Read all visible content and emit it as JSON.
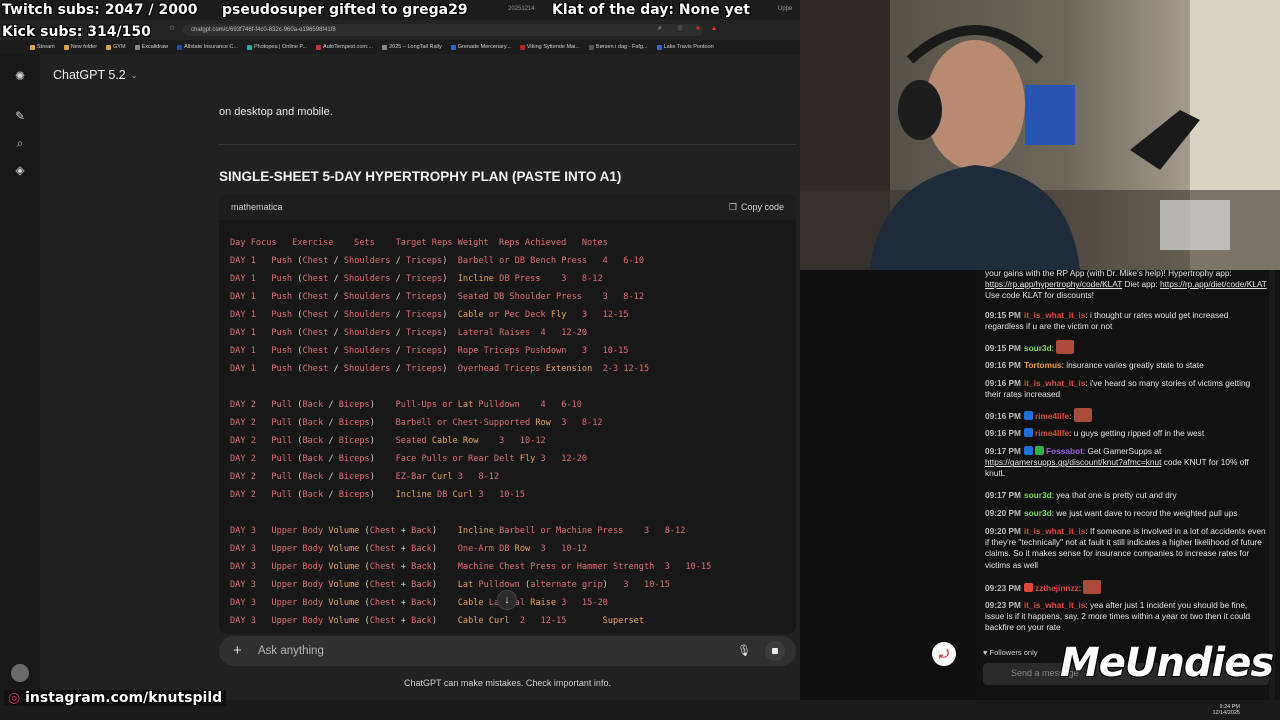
{
  "overlay": {
    "subs": "Twitch subs: 2047 / 2000",
    "gifted": "pseudosuper gifted to grega29",
    "klat": "Klat of the day: None yet",
    "kick": "Kick subs: 314/150",
    "instagram": "instagram.com/knutspild",
    "sponsor": "MeUndies"
  },
  "browser": {
    "tabs": [
      "20251214",
      "Uppe"
    ],
    "url": "chatgpt.com/c/693f746f-f4c0-832c-960a-e196598f41f8",
    "bookmarks": [
      "Stream",
      "New folder",
      "GYM",
      "Excalidraw",
      "Allstate Insurance C...",
      "Photopea | Online P...",
      "AutoTempest.com:...",
      "2025 – LongTail Rally",
      "Grenade Mercenary...",
      "Viking Syttende Mai...",
      "Børsen i dag - Fafg...",
      "Lake Travis Pontoon"
    ]
  },
  "chatgpt": {
    "model": "ChatGPT 5.2",
    "paragraph": "on desktop and mobile.",
    "heading": "SINGLE-SHEET 5-DAY HYPERTROPHY PLAN (PASTE INTO A1)",
    "code_lang": "mathematica",
    "copy_label": "Copy code",
    "composer_placeholder": "Ask anything",
    "disclaimer": "ChatGPT can make mistakes. Check important info.",
    "code_lines": [
      "Day Focus   Exercise    Sets    Target Reps Weight  Reps Achieved   Notes",
      "DAY 1   Push (Chest / Shoulders / Triceps)  Barbell or DB Bench Press   4   6-10",
      "DAY 1   Push (Chest / Shoulders / Triceps)  Incline DB Press    3   8-12",
      "DAY 1   Push (Chest / Shoulders / Triceps)  Seated DB Shoulder Press    3   8-12",
      "DAY 1   Push (Chest / Shoulders / Triceps)  Cable or Pec Deck Fly   3   12-15",
      "DAY 1   Push (Chest / Shoulders / Triceps)  Lateral Raises  4   12-20",
      "DAY 1   Push (Chest / Shoulders / Triceps)  Rope Triceps Pushdown   3   10-15",
      "DAY 1   Push (Chest / Shoulders / Triceps)  Overhead Triceps Extension  2-3 12-15",
      "",
      "DAY 2   Pull (Back / Biceps)    Pull-Ups or Lat Pulldown    4   6-10",
      "DAY 2   Pull (Back / Biceps)    Barbell or Chest-Supported Row  3   8-12",
      "DAY 2   Pull (Back / Biceps)    Seated Cable Row    3   10-12",
      "DAY 2   Pull (Back / Biceps)    Face Pulls or Rear Delt Fly 3   12-20",
      "DAY 2   Pull (Back / Biceps)    EZ-Bar Curl 3   8-12",
      "DAY 2   Pull (Back / Biceps)    Incline DB Curl 3   10-15",
      "",
      "DAY 3   Upper Body Volume (Chest + Back)    Incline Barbell or Machine Press    3   8-12",
      "DAY 3   Upper Body Volume (Chest + Back)    One-Arm DB Row  3   10-12",
      "DAY 3   Upper Body Volume (Chest + Back)    Machine Chest Press or Hammer Strength  3   10-15",
      "DAY 3   Upper Body Volume (Chest + Back)    Lat Pulldown (alternate grip)   3   10-15",
      "DAY 3   Upper Body Volume (Chest + Back)    Cable Lateral Raise 3   15-20",
      "DAY 3   Upper Body Volume (Chest + Back)    Cable Curl  2   12-15       Superset"
    ]
  },
  "chat": {
    "messages": [
      {
        "time": "",
        "user": "",
        "text": "your gains with the RP App (with Dr. Mike's help)! Hypertrophy app:",
        "link": "https://rp.app/hypertrophy/code/KLAT",
        "after": "Diet app:",
        "link2": "https://rp.app/diet/code/KLAT",
        "after2": "Use code KLAT for discounts!"
      },
      {
        "time": "09:15 PM",
        "user": "it_is_what_it_is",
        "color": "#e0463c",
        "text": "i thought ur rates would get increased regardless if u are the victim or not"
      },
      {
        "time": "09:15 PM",
        "user": "sour3d",
        "color": "#7ed957",
        "text": ""
      },
      {
        "time": "09:16 PM",
        "user": "Tortomus",
        "color": "#f0a030",
        "text": "insurance varies greatly state to state"
      },
      {
        "time": "09:16 PM",
        "user": "it_is_what_it_is",
        "color": "#e0463c",
        "text": "i've heard so many stories of victims getting their rates increased"
      },
      {
        "time": "09:16 PM",
        "user": "rime4life",
        "color": "#e0463c",
        "text": ""
      },
      {
        "time": "09:16 PM",
        "user": "rime4life",
        "color": "#e0463c",
        "text": "u guys getting ripped off in the west"
      },
      {
        "time": "09:17 PM",
        "user": "Fossabot",
        "color": "#9b5de5",
        "text": "Get GamerSupps at",
        "link": "https://gamersupps.gg/discount/knut?afmc=knut",
        "after": "code KNUT for 10% off knutL"
      },
      {
        "time": "09:17 PM",
        "user": "sour3d",
        "color": "#7ed957",
        "text": "yea that one is pretty cut and dry"
      },
      {
        "time": "09:20 PM",
        "user": "sour3d",
        "color": "#7ed957",
        "text": "we just want dave to record the weighted pull ups"
      },
      {
        "time": "09:20 PM",
        "user": "it_is_what_it_is",
        "color": "#e0463c",
        "text": "If someone is involved in a lot of accidents even if they're \"technically\" not at fault it still indicates a higher likelihood of future claims. So it makes sense for insurance companies to increase rates for victims as well"
      },
      {
        "time": "09:23 PM",
        "user": "zzthejinnzz",
        "color": "#e0463c",
        "text": ""
      },
      {
        "time": "09:23 PM",
        "user": "it_is_what_it_is",
        "color": "#e0463c",
        "text": "yea after just 1 incident you should be fine, issue is if it happens, say, 2 more times within a year or two then it could backfire on your rate"
      }
    ],
    "followers": "Followers only",
    "send_placeholder": "Send a message"
  },
  "taskbar": {
    "time": "9:24 PM",
    "date": "12/14/2025"
  }
}
